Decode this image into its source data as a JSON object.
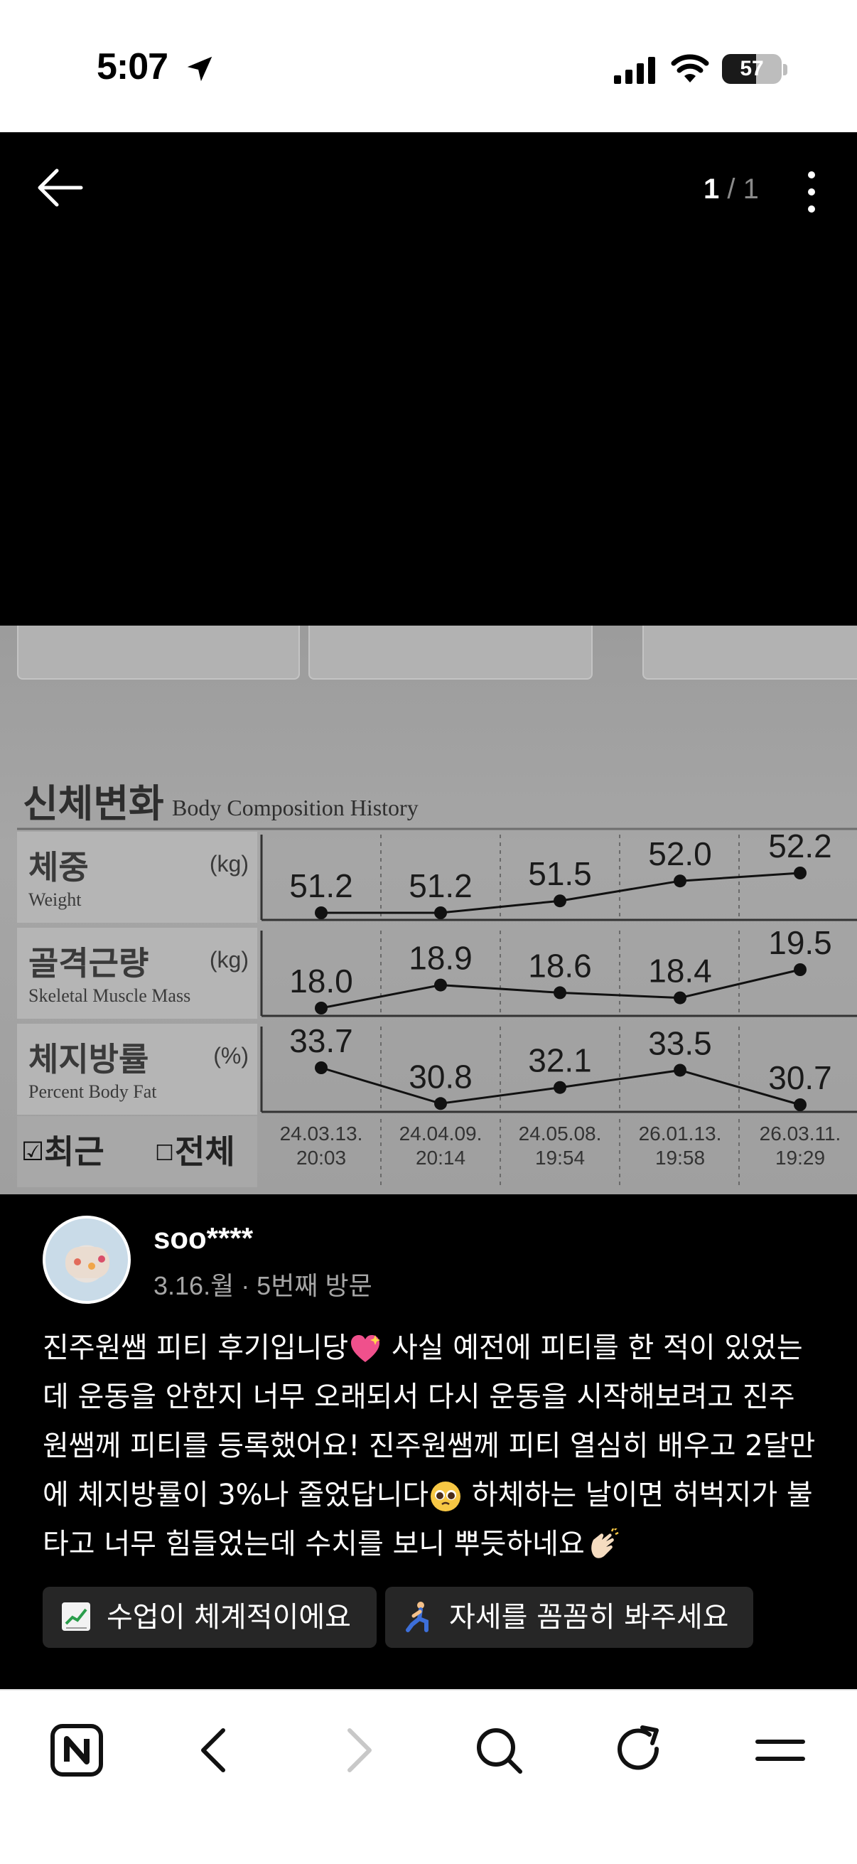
{
  "status_bar": {
    "time": "5:07",
    "battery": "57",
    "battery_level_pct": 57,
    "icons": [
      "location-arrow-icon",
      "cellular-signal-icon",
      "wifi-icon",
      "battery-icon"
    ]
  },
  "viewer": {
    "page_current": "1",
    "page_separator": " / ",
    "page_total": "1",
    "icons": [
      "back-arrow-icon",
      "more-vertical-icon"
    ]
  },
  "photo": {
    "title_ko": "신체변화",
    "title_en": "Body Composition History",
    "rows": [
      {
        "name_ko": "체중",
        "name_en": "Weight",
        "unit": "(kg)",
        "values": [
          "51.2",
          "51.2",
          "51.5",
          "52.0",
          "52.2"
        ]
      },
      {
        "name_ko": "골격근량",
        "name_en": "Skeletal Muscle Mass",
        "unit": "(kg)",
        "values": [
          "18.0",
          "18.9",
          "18.6",
          "18.4",
          "19.5"
        ]
      },
      {
        "name_ko": "체지방률",
        "name_en": "Percent Body Fat",
        "unit": "(%)",
        "values": [
          "33.7",
          "30.8",
          "32.1",
          "33.5",
          "30.7"
        ]
      }
    ],
    "dates": [
      {
        "date": "24.03.13.",
        "time": "20:03"
      },
      {
        "date": "24.04.09.",
        "time": "20:14"
      },
      {
        "date": "24.05.08.",
        "time": "19:54"
      },
      {
        "date": "26.01.13.",
        "time": "19:58"
      },
      {
        "date": "26.03.11.",
        "time": "19:29"
      }
    ],
    "filter_recent": "최근",
    "filter_all": "전체"
  },
  "post": {
    "username": "soo****",
    "visit_info": "3.16.월 · 5번째 방문",
    "review_text_1": "진주원쌤 피티 후기입니당",
    "review_text_2": " 사실 예전에 피티를 한 적이 있었는데 운동을 안한지 너무 오래되서 다시 운동을 시작해보려고 진주원쌤께 피티를 등록했어요! 진주원쌤께 피티 열심히 배우고 2달만에 체지방률이 3%나 줄었답니다",
    "review_text_3": " 하체하는 날이면 허벅지가 불타고 너무 힘들었는데 수치를 보니 뿌듯하네요",
    "tags": [
      {
        "icon": "chart-increasing-icon",
        "label": "수업이 체계적이에요"
      },
      {
        "icon": "person-kneeling-icon",
        "label": "자세를 꼼꼼히 봐주세요"
      }
    ]
  },
  "bottom_nav": {
    "icons": [
      "naver-home-icon",
      "back-icon",
      "forward-icon",
      "search-icon",
      "refresh-icon",
      "menu-icon"
    ]
  },
  "colors": {
    "background": "#000000",
    "text": "#ffffff",
    "muted": "#a6a6a6",
    "chip": "#262626",
    "nav_bg": "#ffffff"
  }
}
